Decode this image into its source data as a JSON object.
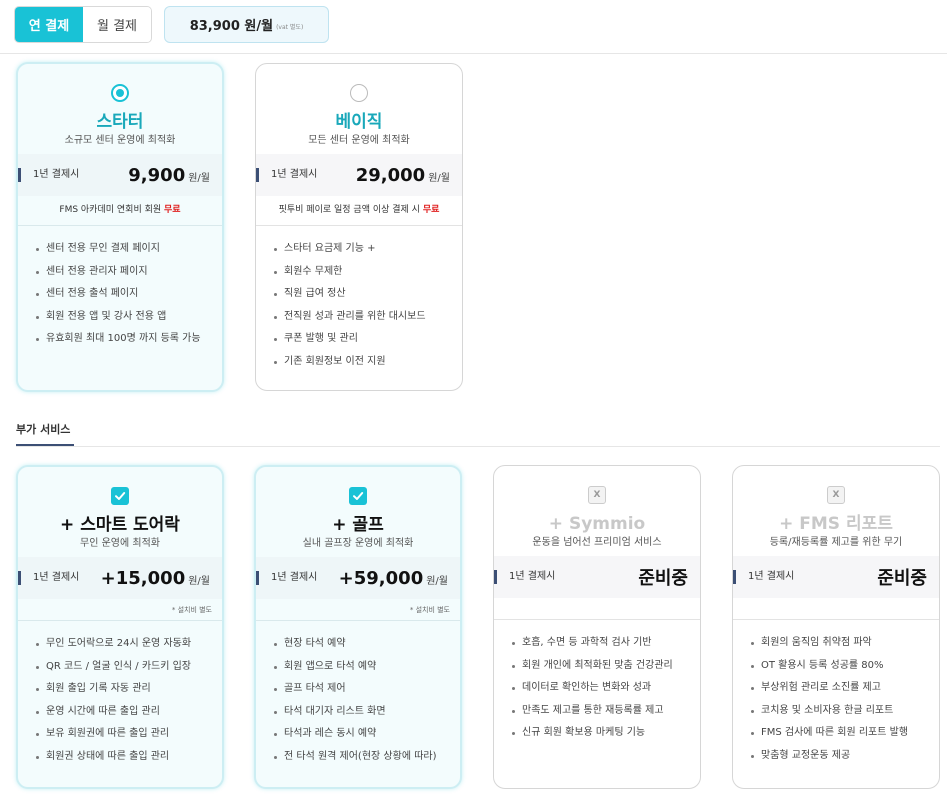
{
  "billing": {
    "annual_label": "연 결제",
    "monthly_label": "월 결제",
    "total_price": "83,900 원/월",
    "total_vat": "(vat 별도)"
  },
  "plans": [
    {
      "name": "스타터",
      "desc": "소규모 센터 운영에 최적화",
      "selected": true,
      "price_label": "1년 결제시",
      "price": "9,900",
      "unit": "원/월",
      "note_text": "FMS 아카데미 연회비 회원",
      "note_free": "무료",
      "features": [
        "센터 전용 무인 결제 페이지",
        "센터 전용 관리자 페이지",
        "센터 전용 출석 페이지",
        "회원 전용 앱 및 강사 전용 앱",
        "유효회원 최대 100명 까지 등록 가능"
      ]
    },
    {
      "name": "베이직",
      "desc": "모든 센터 운영에 최적화",
      "selected": false,
      "price_label": "1년 결제시",
      "price": "29,000",
      "unit": "원/월",
      "note_text": "핏투비 페이로 일정 금액 이상 결제 시",
      "note_free": "무료",
      "features": [
        "스타터 요금제 기능 +",
        "회원수 무제한",
        "직원 급여 정산",
        "전직원 성과 관리를 위한 대시보드",
        "쿠폰 발행 및 관리",
        "기존 회원정보 이전 지원"
      ]
    }
  ],
  "addons_title": "부가 서비스",
  "addons": [
    {
      "name": "+ 스마트 도어락",
      "desc": "무인 운영에 최적화",
      "state": "checked",
      "price_label": "1년 결제시",
      "price": "+15,000",
      "unit": "원/월",
      "install_note": "* 설치비 별도",
      "features": [
        "무인 도어락으로 24시 운영 자동화",
        "QR 코드 / 얼굴 인식 / 카드키 입장",
        "회원 출입 기록 자동 관리",
        "운영 시간에 따른 출입 관리",
        "보유 회원권에 따른 출입 관리",
        "회원권 상태에 따른 출입 관리"
      ]
    },
    {
      "name": "+ 골프",
      "desc": "실내 골프장 운영에 최적화",
      "state": "checked",
      "price_label": "1년 결제시",
      "price": "+59,000",
      "unit": "원/월",
      "install_note": "* 설치비 별도",
      "features": [
        "현장 타석 예약",
        "회원 앱으로 타석 예약",
        "골프 타석 제어",
        "타석 대기자 리스트 화면",
        "타석과 레슨 동시 예약",
        "전 타석 원격 제어(현장 상황에 따라)"
      ]
    },
    {
      "name": "+ Symmio",
      "desc": "운동을 넘어선 프리미엄 서비스",
      "state": "disabled",
      "disabled_mark": "X",
      "price_label": "1년 결제시",
      "status": "준비중",
      "features": [
        "호흡, 수면 등 과학적 검사 기반",
        "회원 개인에 최적화된 맞춤 건강관리",
        "데이터로 확인하는 변화와 성과",
        "만족도 제고를 통한 재등록률 제고",
        "신규 회원 확보용 마케팅 기능"
      ]
    },
    {
      "name": "+ FMS 리포트",
      "desc": "등록/재등록률 제고를 위한 무기",
      "state": "disabled",
      "disabled_mark": "X",
      "price_label": "1년 결제시",
      "status": "준비중",
      "features": [
        "회원의 움직임 취약점 파악",
        "OT 활용시 등록 성공률 80%",
        "부상위험 관리로 소진률 제고",
        "코치용 및 소비자용 한글 리포트",
        "FMS 검사에 따른 회원 리포트 발행",
        "맞춤형 교정운동 제공"
      ]
    }
  ],
  "colors": {
    "accent": "#19c2d6",
    "free": "#e02020",
    "navy": "#3c4f75"
  }
}
